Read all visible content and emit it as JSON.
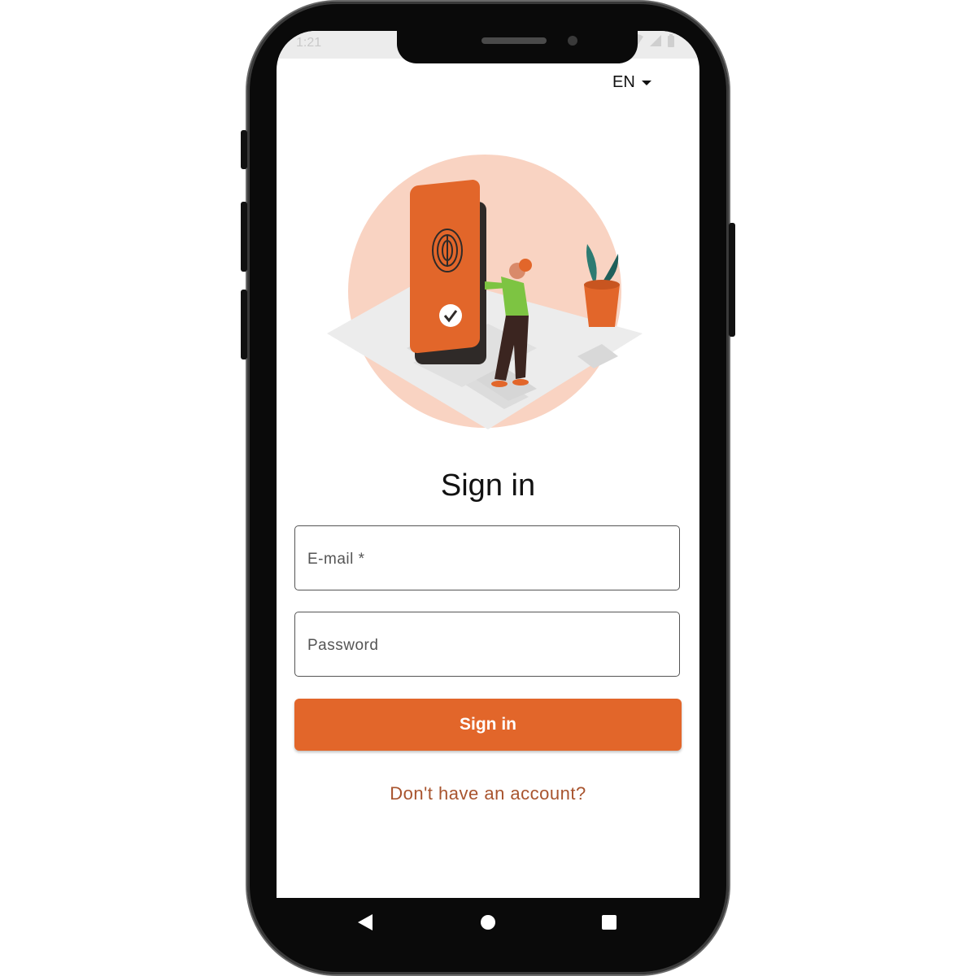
{
  "status_bar": {
    "time": "1:21"
  },
  "language_selector": {
    "value": "EN"
  },
  "page": {
    "title": "Sign in"
  },
  "form": {
    "email_label": "E-mail *",
    "password_label": "Password",
    "submit_label": "Sign in"
  },
  "footer": {
    "signup_link": "Don't have an account?"
  },
  "colors": {
    "accent": "#e2662a",
    "link": "#a8542e",
    "illustration_bg": "#f9d3c2"
  },
  "icons": [
    "wifi-icon",
    "signal-icon",
    "battery-icon",
    "caret-down-icon",
    "back-icon",
    "home-icon",
    "recents-icon"
  ]
}
